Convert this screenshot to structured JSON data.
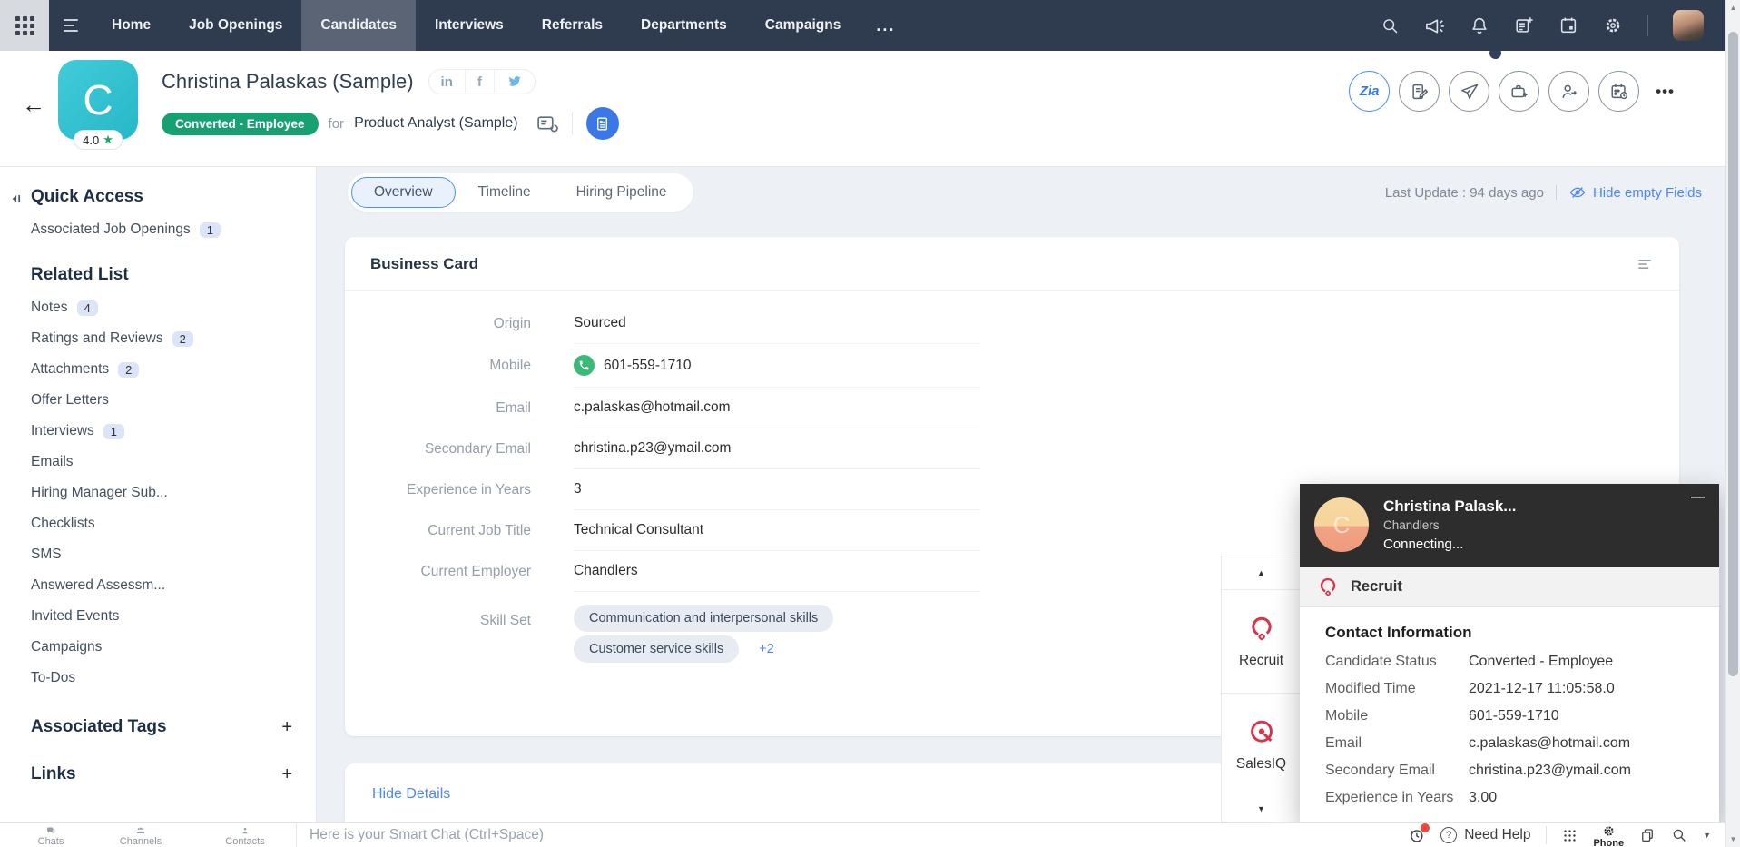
{
  "topnav": {
    "menu": [
      {
        "label": "Home",
        "active": false
      },
      {
        "label": "Job Openings",
        "active": false
      },
      {
        "label": "Candidates",
        "active": true
      },
      {
        "label": "Interviews",
        "active": false
      },
      {
        "label": "Referrals",
        "active": false
      },
      {
        "label": "Departments",
        "active": false
      },
      {
        "label": "Campaigns",
        "active": false
      }
    ],
    "more_label": "...",
    "right_icons": [
      "search-icon",
      "announcement-icon",
      "notifications-icon",
      "create-note-icon",
      "calendar-icon",
      "settings-icon",
      "user-avatar"
    ]
  },
  "header": {
    "back": "←",
    "avatar_letter": "C",
    "rating": "4.0",
    "rating_star": "★",
    "name": "Christina Palaskas (Sample)",
    "social": {
      "linkedin": "in",
      "facebook": "f",
      "twitter": "twitter-icon"
    },
    "status": "Converted - Employee",
    "for_label": "for",
    "job": "Product Analyst (Sample)",
    "actions": {
      "zia": "Zia",
      "more": "•••"
    },
    "action_icons": [
      "zia-button",
      "edit-note-icon",
      "send-mail-icon",
      "add-to-job-icon",
      "submit-candidate-icon",
      "schedule-interview-icon"
    ]
  },
  "sidebar": {
    "quick_access": {
      "title": "Quick Access",
      "items": [
        {
          "label": "Associated Job Openings",
          "badge": "1"
        }
      ]
    },
    "related": {
      "title": "Related List",
      "items": [
        {
          "label": "Notes",
          "badge": "4"
        },
        {
          "label": "Ratings and Reviews",
          "badge": "2"
        },
        {
          "label": "Attachments",
          "badge": "2"
        },
        {
          "label": "Offer Letters"
        },
        {
          "label": "Interviews",
          "badge": "1"
        },
        {
          "label": "Emails"
        },
        {
          "label": "Hiring Manager Sub..."
        },
        {
          "label": "Checklists"
        },
        {
          "label": "SMS"
        },
        {
          "label": "Answered Assessm..."
        },
        {
          "label": "Invited Events"
        },
        {
          "label": "Campaigns"
        },
        {
          "label": "To-Dos"
        }
      ]
    },
    "tags": {
      "title": "Associated Tags",
      "add": "+"
    },
    "links": {
      "title": "Links",
      "add": "+"
    }
  },
  "main": {
    "tabs": [
      {
        "label": "Overview",
        "active": true
      },
      {
        "label": "Timeline",
        "active": false
      },
      {
        "label": "Hiring Pipeline",
        "active": false
      }
    ],
    "last_update": "Last Update : 94 days ago",
    "hide_empty": "Hide empty Fields",
    "business_card": {
      "title": "Business Card",
      "fields": [
        {
          "label": "Origin",
          "value": "Sourced"
        },
        {
          "label": "Mobile",
          "value": "601-559-1710",
          "phone": true
        },
        {
          "label": "Email",
          "value": "c.palaskas@hotmail.com"
        },
        {
          "label": "Secondary Email",
          "value": "christina.p23@ymail.com"
        },
        {
          "label": "Experience in Years",
          "value": "3"
        },
        {
          "label": "Current Job Title",
          "value": "Technical Consultant"
        },
        {
          "label": "Current Employer",
          "value": "Chandlers"
        }
      ],
      "skill_label": "Skill Set",
      "skills_line1": [
        "Communication and interpersonal skills"
      ],
      "skills_line2": [
        "Customer service skills"
      ],
      "more_skills": "+2"
    },
    "hide_details": "Hide Details"
  },
  "side_toolbar": {
    "up_arrow": "▲",
    "down_arrow": "▼",
    "apps": [
      {
        "label": "Recruit"
      },
      {
        "label": "SalesIQ"
      }
    ]
  },
  "call_widget": {
    "minimize": "—",
    "avatar_letter": "C",
    "name": "Christina Palask...",
    "company": "Chandlers",
    "status": "Connecting...",
    "app": "Recruit",
    "section_title": "Contact Information",
    "rows": [
      {
        "label": "Candidate Status",
        "value": "Converted - Employee"
      },
      {
        "label": "Modified Time",
        "value": "2021-12-17 11:05:58.0"
      },
      {
        "label": "Mobile",
        "value": "601-559-1710"
      },
      {
        "label": "Email",
        "value": "c.palaskas@hotmail.com"
      },
      {
        "label": "Secondary Email",
        "value": "christina.p23@ymail.com"
      },
      {
        "label": "Experience in Years",
        "value": "3.00"
      }
    ]
  },
  "bottombar": {
    "tools": [
      {
        "label": "Chats"
      },
      {
        "label": "Channels"
      },
      {
        "label": "Contacts"
      }
    ],
    "chat_placeholder": "Here is your Smart Chat (Ctrl+Space)",
    "need_help": "Need Help",
    "help_mark": "?",
    "phone_label": "Phone",
    "down_caret": "▼"
  },
  "colors": {
    "nav_bg": "#2f3b4e",
    "accent_blue": "#4d86f5",
    "status_green": "#17a173",
    "brand_red": "#d8334a",
    "avatar_cyan": "#35c6d6",
    "page_bg": "#edf0f5"
  }
}
